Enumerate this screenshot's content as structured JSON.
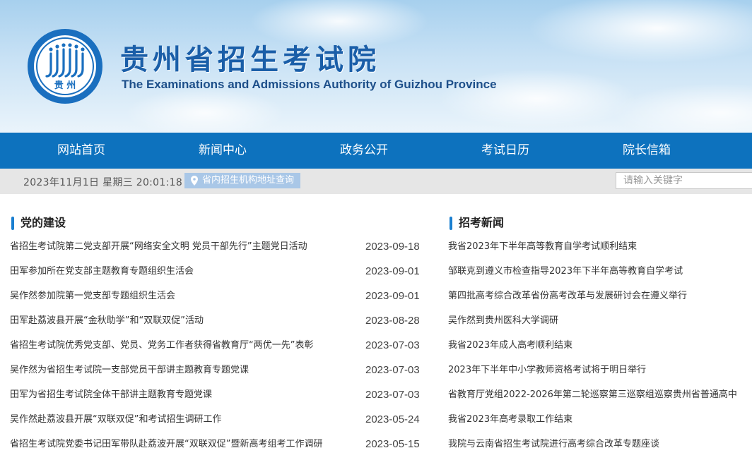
{
  "header": {
    "title_cn": "贵州省招生考试院",
    "title_en": "The Examinations and Admissions Authority of Guizhou Province",
    "logo_text": "贵 州"
  },
  "nav": {
    "items": [
      {
        "label": "网站首页"
      },
      {
        "label": "新闻中心"
      },
      {
        "label": "政务公开"
      },
      {
        "label": "考试日历"
      },
      {
        "label": "院长信箱"
      }
    ]
  },
  "infobar": {
    "datetime": "2023年11月1日 星期三 20:01:18",
    "address_link": "省内招生机构地址查询",
    "search_placeholder": "请输入关键字"
  },
  "party": {
    "heading": "党的建设",
    "items": [
      {
        "title": "省招生考试院第二党支部开展“网络安全文明 党员干部先行”主题党日活动",
        "date": "2023-09-18"
      },
      {
        "title": "田军参加所在党支部主题教育专题组织生活会",
        "date": "2023-09-01"
      },
      {
        "title": "吴作然参加院第一党支部专题组织生活会",
        "date": "2023-09-01"
      },
      {
        "title": "田军赴荔波县开展“金秋助学”和“双联双促”活动",
        "date": "2023-08-28"
      },
      {
        "title": "省招生考试院优秀党支部、党员、党务工作者获得省教育厅“两优一先”表彰",
        "date": "2023-07-03"
      },
      {
        "title": "吴作然为省招生考试院一支部党员干部讲主题教育专题党课",
        "date": "2023-07-03"
      },
      {
        "title": "田军为省招生考试院全体干部讲主题教育专题党课",
        "date": "2023-07-03"
      },
      {
        "title": "吴作然赴荔波县开展“双联双促”和考试招生调研工作",
        "date": "2023-05-24"
      },
      {
        "title": "省招生考试院党委书记田军带队赴荔波开展“双联双促”暨新高考组考工作调研",
        "date": "2023-05-15"
      }
    ]
  },
  "admission": {
    "heading": "招考新闻",
    "items": [
      {
        "title": "我省2023年下半年高等教育自学考试顺利结束"
      },
      {
        "title": "邹联克到遵义市检查指导2023年下半年高等教育自学考试"
      },
      {
        "title": "第四批高考综合改革省份高考改革与发展研讨会在遵义举行"
      },
      {
        "title": "吴作然到贵州医科大学调研"
      },
      {
        "title": "我省2023年成人高考顺利结束"
      },
      {
        "title": "2023年下半年中小学教师资格考试将于明日举行"
      },
      {
        "title": "省教育厅党组2022-2026年第二轮巡察第三巡察组巡察贵州省普通高中"
      },
      {
        "title": "我省2023年高考录取工作结束"
      },
      {
        "title": "我院与云南省招生考试院进行高考综合改革专题座谈"
      }
    ]
  },
  "colors": {
    "nav_bg": "#0d72be",
    "title_blue": "#1a5ea8",
    "accent_bar": "#1a7fd0",
    "infobar_bg": "#e6e6e6",
    "address_btn_bg": "#a9c7e7"
  }
}
